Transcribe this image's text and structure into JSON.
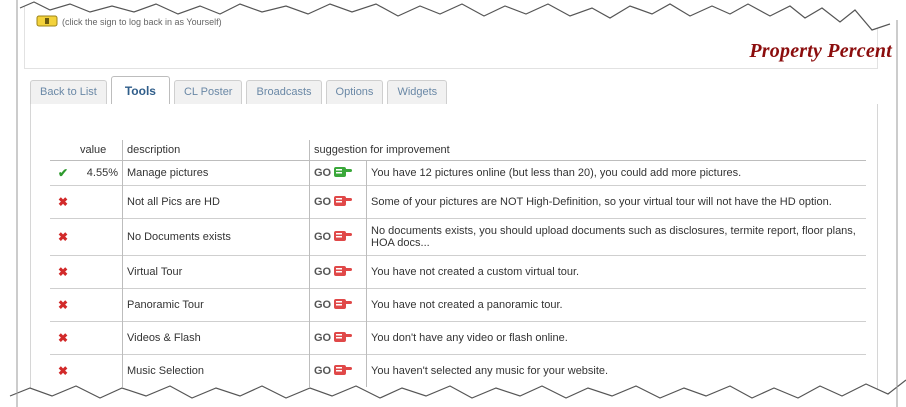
{
  "header": {
    "hint": "(click the sign to log back in as Yourself)",
    "brand": "Property Percent"
  },
  "tabs": [
    {
      "label": "Back to List"
    },
    {
      "label": "Tools"
    },
    {
      "label": "CL Poster"
    },
    {
      "label": "Broadcasts"
    },
    {
      "label": "Options"
    },
    {
      "label": "Widgets"
    }
  ],
  "table": {
    "headers": {
      "value": "value",
      "description": "description",
      "suggestion": "suggestion for improvement"
    },
    "go_label": "GO",
    "rows": [
      {
        "status": "done",
        "value": "4.55%",
        "description": "Manage pictures",
        "suggestion": "You have 12 pictures online (but less than 20), you could add more pictures."
      },
      {
        "status": "todo",
        "value": "",
        "description": "Not all Pics are HD",
        "suggestion": "Some of your pictures are NOT High-Definition, so your virtual tour will not have the HD option."
      },
      {
        "status": "todo",
        "value": "",
        "description": "No Documents exists",
        "suggestion": "No documents exists, you should upload documents such as disclosures, termite report, floor plans, HOA docs..."
      },
      {
        "status": "todo",
        "value": "",
        "description": "Virtual Tour",
        "suggestion": "You have not created a custom virtual tour."
      },
      {
        "status": "todo",
        "value": "",
        "description": "Panoramic Tour",
        "suggestion": "You have not created a panoramic tour."
      },
      {
        "status": "todo",
        "value": "",
        "description": "Videos & Flash",
        "suggestion": "You don't have any video or flash online."
      },
      {
        "status": "todo",
        "value": "",
        "description": "Music Selection",
        "suggestion": "You haven't selected any music for your website."
      }
    ]
  },
  "icons": {
    "done": "check-icon",
    "todo": "cross-icon",
    "go_done": "pointing-hand-green-icon",
    "go_todo": "pointing-hand-red-icon",
    "hint": "warning-sign-icon"
  },
  "colors": {
    "brand": "#8b0d0d",
    "check": "#2e9a2e",
    "cross": "#d22a2a",
    "tab_text": "#6a88a6"
  }
}
